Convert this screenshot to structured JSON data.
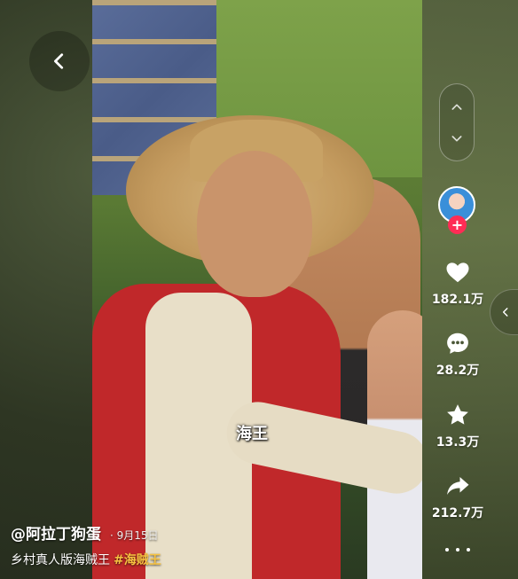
{
  "video": {
    "subtitle": "海王"
  },
  "actions": {
    "like_count": "182.1万",
    "comment_count": "28.2万",
    "favorite_count": "13.3万",
    "share_count": "212.7万"
  },
  "info": {
    "author": "@阿拉丁狗蛋",
    "date": "· 9月15日",
    "caption": "乡村真人版海贼王",
    "hashtag": "#海贼王"
  },
  "icons": {
    "back": "chevron-left-icon",
    "prev": "chevron-up-icon",
    "next": "chevron-down-icon",
    "like": "heart-icon",
    "comment": "comment-icon",
    "favorite": "star-icon",
    "share": "share-icon",
    "more": "more-icon",
    "expand": "chevron-left-icon"
  },
  "colors": {
    "follow_accent": "#fe2c55",
    "hashtag": "#f7c240"
  }
}
